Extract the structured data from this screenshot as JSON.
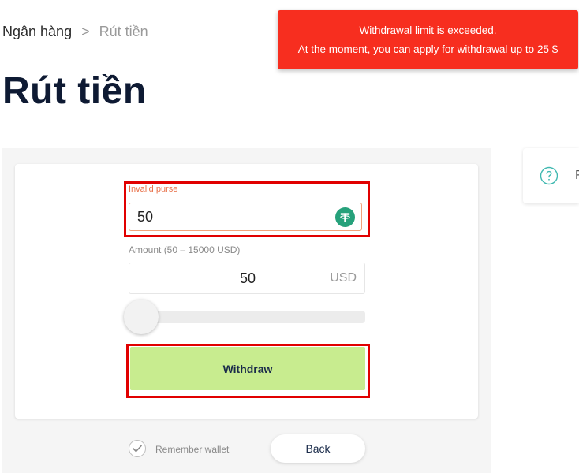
{
  "breadcrumb": {
    "root": "Ngân hàng",
    "separator": ">",
    "current": "Rút tiền"
  },
  "page": {
    "title": "Rút tiền"
  },
  "toast": {
    "line1": "Withdrawal limit is exceeded.",
    "line2": "At the moment, you can apply for withdrawal up to 25 $",
    "color": "#f72e1f"
  },
  "form": {
    "purse": {
      "error_label": "Invalid purse",
      "value": "50",
      "icon": "tether-icon"
    },
    "amount": {
      "label": "Amount (50 – 15000 USD)",
      "value": "50",
      "currency": "USD"
    },
    "slider": {
      "min": 50,
      "max": 15000,
      "value": 50
    },
    "withdraw_label": "Withdraw",
    "remember_label": "Remember wallet",
    "back_label": "Back"
  },
  "side_panel": {
    "icon": "help-circle-icon",
    "text": "F"
  },
  "colors": {
    "withdraw_button": "#c8ec8f",
    "highlight": "#e10000",
    "error_text": "#e8714a",
    "tether": "#26a17b"
  }
}
